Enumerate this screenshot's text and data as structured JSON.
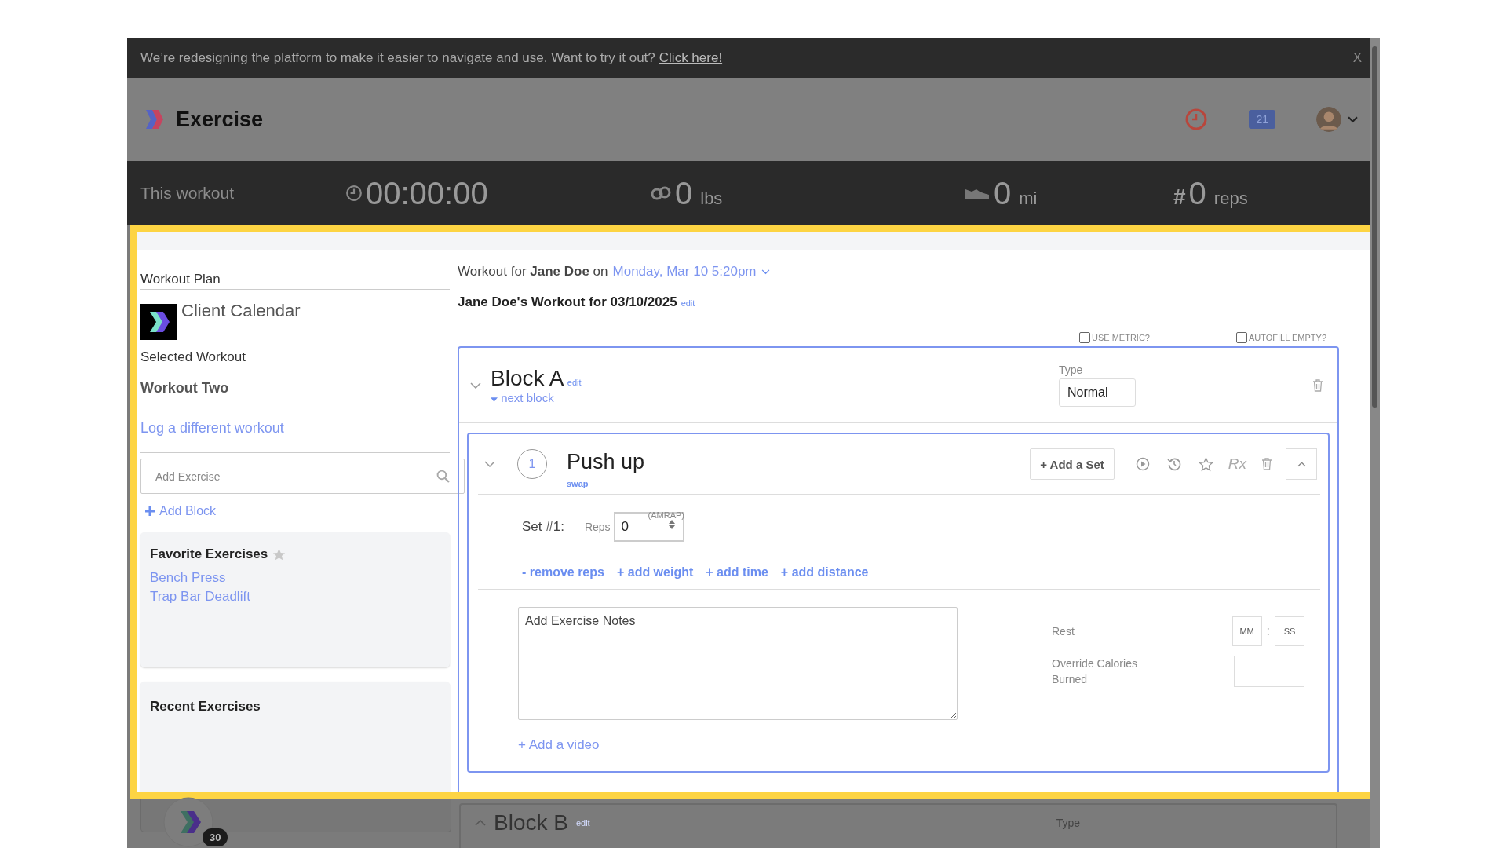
{
  "banner": {
    "text": "We’re redesigning the platform to make it easier to navigate and use. Want to try it out?",
    "link": "Click here!",
    "close": "X"
  },
  "header": {
    "title": "Exercise",
    "calendar_badge": "21"
  },
  "stats": {
    "label": "This workout",
    "items": [
      {
        "kind": "time",
        "value": "00:00:00"
      },
      {
        "kind": "weight",
        "value": "0",
        "unit": "lbs"
      },
      {
        "kind": "distance",
        "value": "0",
        "unit": "mi"
      },
      {
        "kind": "reps",
        "icon": "#",
        "value": "0",
        "unit": "reps"
      }
    ]
  },
  "sidebar": {
    "plan_label": "Workout Plan",
    "plan_name": "Client Calendar",
    "selected_label": "Selected Workout",
    "workout_name": "Workout Two",
    "log_link": "Log a different workout",
    "add_exercise": {
      "placeholder": "Add Exercise"
    },
    "add_block": "Add Block",
    "favorites": {
      "title": "Favorite Exercises",
      "items": [
        "Bench Press",
        "Trap Bar Deadlift"
      ]
    },
    "recent": {
      "title": "Recent Exercises"
    }
  },
  "workout": {
    "for_text": "Workout for **Jane Doe** on",
    "date": "Monday, Mar 10 5:20pm",
    "title": "Jane Doe's Workout for 03/10/2025",
    "edit": "edit",
    "options": [
      {
        "label": "USE METRIC?",
        "checked": false
      },
      {
        "label": "AUTOFILL EMPTY?",
        "checked": false
      }
    ]
  },
  "block": {
    "name": "Block A",
    "edit": "edit",
    "next_block": "next block",
    "expanded": true,
    "type_label": "Type",
    "type_value": "Normal",
    "exercise": {
      "number": "1",
      "name": "Push up",
      "swap": "swap",
      "add_set": "+ Add a Set",
      "rx": "Rx",
      "expanded": true,
      "sets": [
        {
          "label": "Set #1:",
          "reps_label": "Reps",
          "reps_value": "0",
          "hint": "(AMRAP)"
        }
      ],
      "actions": [
        "- remove reps",
        "+ add weight",
        "+ add time",
        "+ add distance"
      ],
      "notes": {
        "placeholder": "Add Exercise Notes"
      },
      "rest_label": "Rest",
      "rest_minutes": {
        "placeholder": "MM"
      },
      "rest_separator": ":",
      "rest_seconds": {
        "placeholder": "SS"
      },
      "calories_label": "Override Calories Burned",
      "add_video": "+ Add a video"
    }
  },
  "next_block": {
    "name": "Block B",
    "edit": "edit",
    "expanded": false,
    "type_label": "Type"
  },
  "floating_badge": "30"
}
